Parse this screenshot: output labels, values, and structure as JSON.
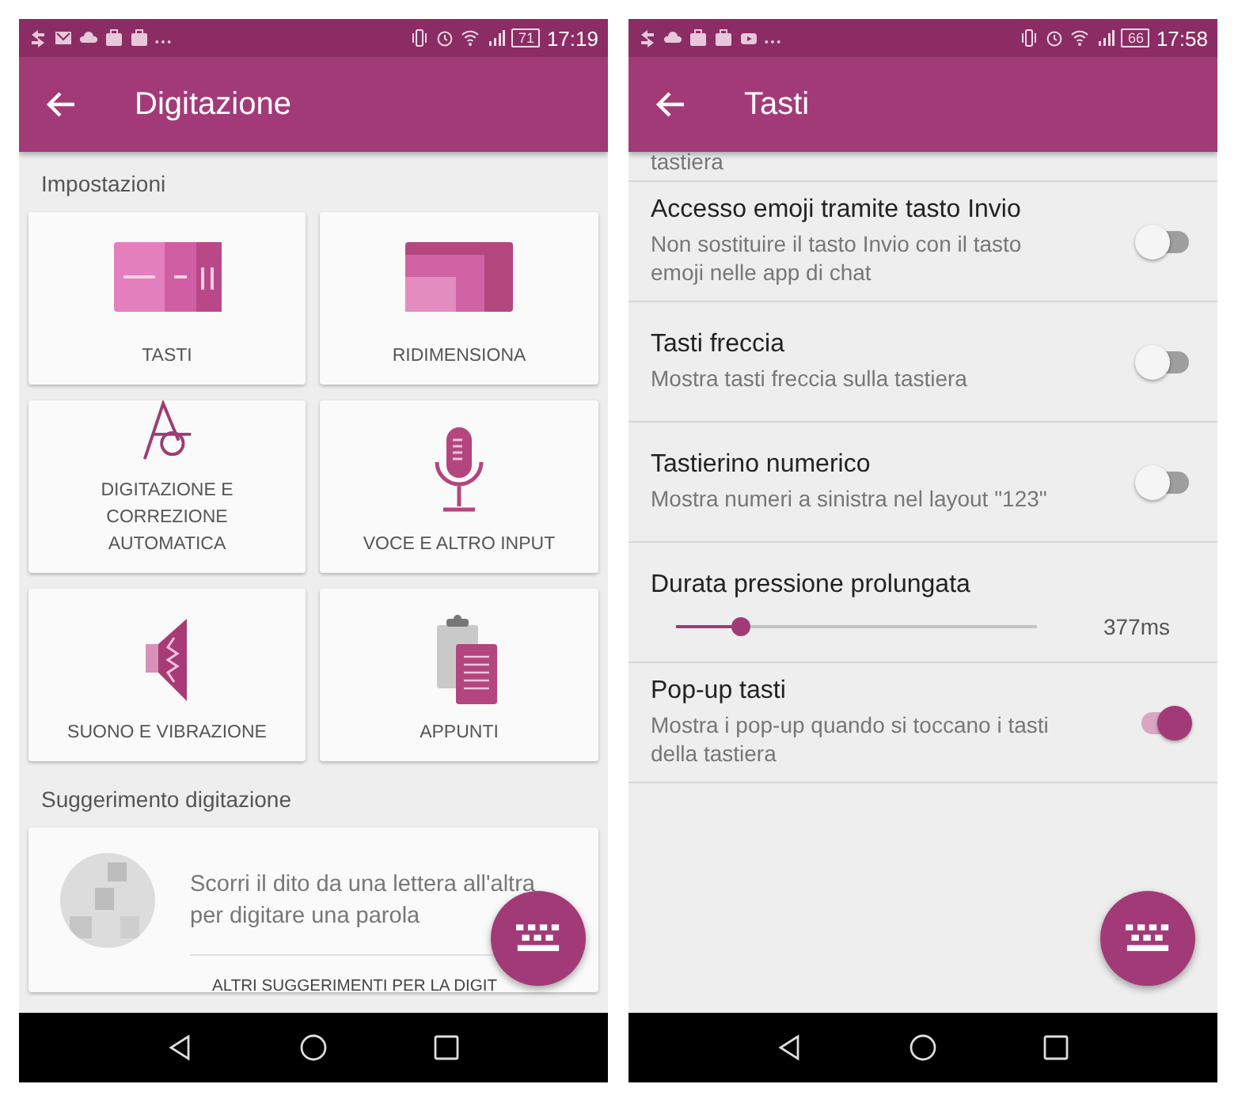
{
  "left_screen": {
    "status_bar": {
      "battery": "71",
      "time": "17:19"
    },
    "title": "Digitazione",
    "section_title": "Impostazioni",
    "tiles": [
      {
        "label": "TASTI"
      },
      {
        "label": "RIDIMENSIONA"
      },
      {
        "label": "DIGITAZIONE E CORREZIONE AUTOMATICA"
      },
      {
        "label": "VOCE E ALTRO INPUT"
      },
      {
        "label": "SUONO E VIBRAZIONE"
      },
      {
        "label": "APPUNTI"
      }
    ],
    "tip_section_title": "Suggerimento digitazione",
    "tip": {
      "text": "Scorri il dito da una lettera all'altra per digitare una parola",
      "link": "ALTRI SUGGERIMENTI PER LA DIGIT"
    }
  },
  "right_screen": {
    "status_bar": {
      "battery": "66",
      "time": "17:58"
    },
    "title": "Tasti",
    "cut_text": "tastiera",
    "settings": [
      {
        "kind": "toggle",
        "title": "Accesso emoji tramite tasto Invio",
        "subtitle": "Non sostituire il tasto Invio con il tasto emoji nelle app di chat",
        "on": false
      },
      {
        "kind": "toggle",
        "title": "Tasti freccia",
        "subtitle": "Mostra tasti freccia sulla tastiera",
        "on": false
      },
      {
        "kind": "toggle",
        "title": "Tastierino numerico",
        "subtitle": "Mostra numeri a sinistra nel layout \"123\"",
        "on": false
      },
      {
        "kind": "slider",
        "title": "Durata pressione prolungata",
        "reading": "377ms"
      },
      {
        "kind": "toggle",
        "title": "Pop-up tasti",
        "subtitle": "Mostra i pop-up quando si toccano i tasti della tastiera",
        "on": true
      }
    ]
  }
}
